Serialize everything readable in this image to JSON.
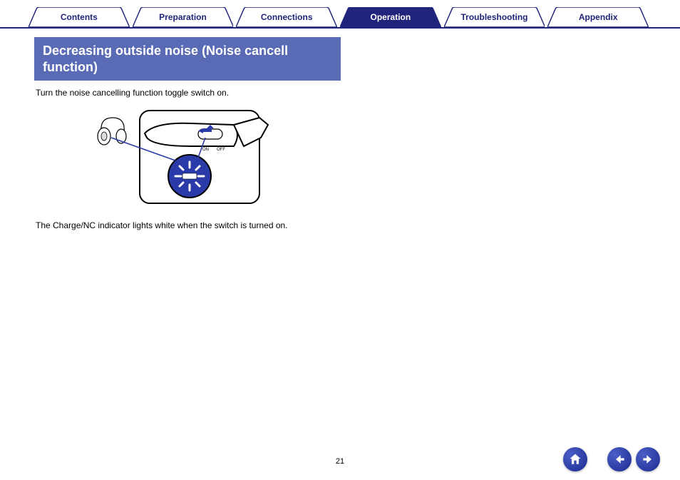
{
  "tabs": [
    {
      "label": "Contents",
      "active": false
    },
    {
      "label": "Preparation",
      "active": false
    },
    {
      "label": "Connections",
      "active": false
    },
    {
      "label": "Operation",
      "active": true
    },
    {
      "label": "Troubleshooting",
      "active": false
    },
    {
      "label": "Appendix",
      "active": false
    }
  ],
  "section": {
    "title": "Decreasing outside noise (Noise cancell function)",
    "intro": "Turn the noise cancelling function toggle switch on.",
    "caption": "The Charge/NC indicator lights white when the switch is turned on."
  },
  "diagram": {
    "switch_on_label": "ON",
    "switch_off_label": "OFF"
  },
  "page_number": "21",
  "colors": {
    "brand": "#20247a",
    "header_bg": "#5a6bb5",
    "nav_btn": "#2a3aa8"
  }
}
